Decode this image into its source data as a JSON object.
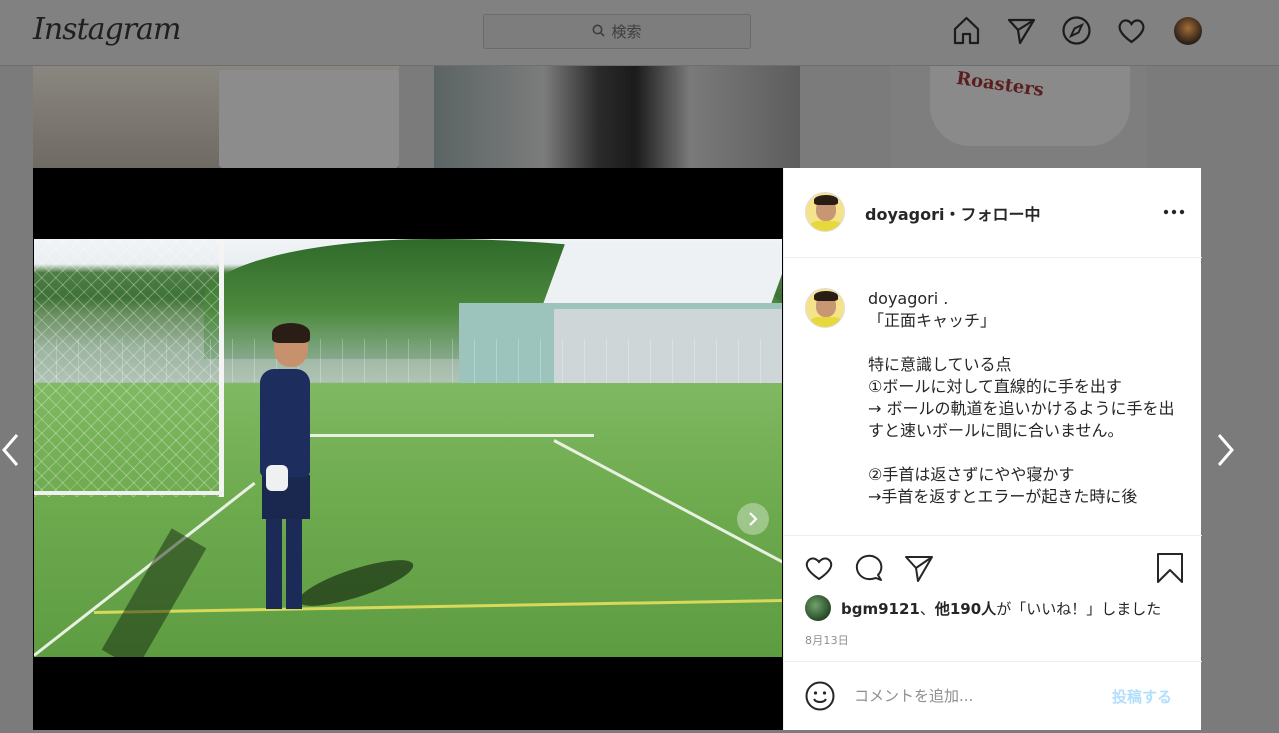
{
  "header": {
    "logo": "Instagram",
    "search_placeholder": "検索"
  },
  "background_tile": {
    "cup_text": "Roasters"
  },
  "post": {
    "username": "doyagori",
    "follow_status": "・フォロー中",
    "caption_user": "doyagori",
    "caption_body": " .\n「正面キャッチ」\n\n特に意識している点\n①ボールに対して直線的に手を出す\n→ ボールの軌道を追いかけるように手を出すと速いボールに間に合いません。\n\n②手首は返さずにやや寝かす\n→手首を返すとエラーが起きた時に後",
    "likes_user": "bgm9121",
    "likes_separator": "、",
    "likes_others": "他190人",
    "likes_suffix": "が「いいね！」しました",
    "date": "8月13日",
    "comment_placeholder": "コメントを追加...",
    "post_button": "投稿する",
    "carousel": {
      "count": 2,
      "active": 1
    }
  },
  "icons": {
    "home": "home-icon",
    "direct": "paper-plane-icon",
    "explore": "compass-icon",
    "activity": "heart-icon",
    "like": "heart-outline-icon",
    "comment": "speech-bubble-icon",
    "share": "paper-plane-icon",
    "save": "bookmark-icon",
    "mute": "speaker-muted-icon",
    "emoji": "smiley-icon"
  },
  "colors": {
    "post_button_disabled": "#b2dffc",
    "overlay": "#7b7b7b"
  }
}
